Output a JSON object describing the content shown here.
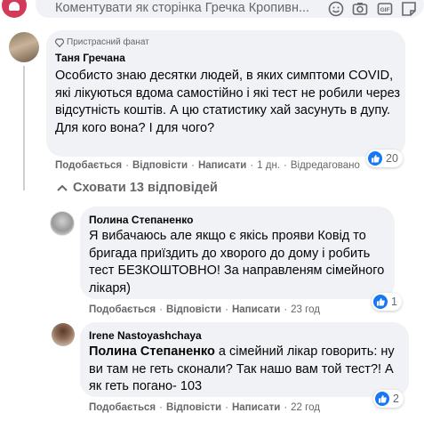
{
  "composer": {
    "placeholder": "Коментувати як сторінка Гречка Кропивн...",
    "icons": [
      "emoji-icon",
      "camera-icon",
      "gif-icon",
      "sticker-icon"
    ]
  },
  "comments": [
    {
      "badge": "Пристрасний фанат",
      "author": "Таня Гречана",
      "text": "Особисто знаю десятки людей, в яких симптоми COVID, які лікуються вдома самостійно і які тест не робили через відсутність коштів. А цю статистику хай засунуть в дупу. Для кого вона? І для чого?",
      "like": "Подобається",
      "reply": "Відповісти",
      "write": "Написати",
      "time": "1 дн.",
      "edited": "Відредаговано",
      "reactions": "20"
    }
  ],
  "hide_replies": "Сховати 13 відповідей",
  "replies": [
    {
      "author": "Полина Степаненко",
      "text": "Я вибачаюсь але якщо є якісь прояви Ковід то бригада приїздить до хворого до дому і робить тест БЕЗКОШТОВНО! За направленям сімейного лікаря)",
      "like": "Подобається",
      "reply": "Відповісти",
      "write": "Написати",
      "time": "23 год",
      "reactions": "1"
    },
    {
      "author": "Irene Nastoyashchaya",
      "tag": "Полина Степаненко",
      "text": " а сімейний лікар говорить: ну ви там не геть сконали? Так нашо вам той тест?! А як геть погано- 103",
      "like": "Подобається",
      "reply": "Відповісти",
      "write": "Написати",
      "time": "22 год",
      "reactions": "2"
    }
  ],
  "colors": {
    "bubble": "#f0f2f5",
    "secondary_text": "#65676b",
    "like_blue": "#1877f2"
  }
}
